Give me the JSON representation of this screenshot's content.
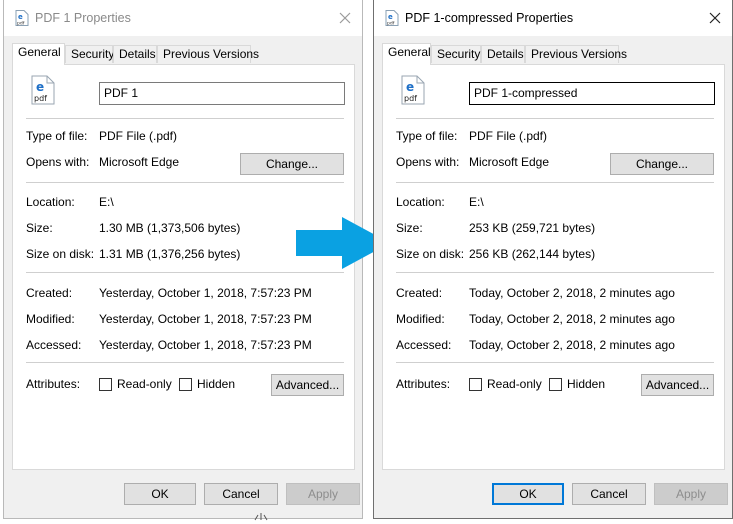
{
  "left": {
    "title": "PDF 1 Properties",
    "tabs": [
      "General",
      "Security",
      "Details",
      "Previous Versions"
    ],
    "file_name": "PDF 1",
    "type_label": "Type of file:",
    "type_value": "PDF File (.pdf)",
    "opens_label": "Opens with:",
    "opens_value": "Microsoft Edge",
    "change_button": "Change...",
    "location_label": "Location:",
    "location_value": "E:\\",
    "size_label": "Size:",
    "size_value": "1.30 MB (1,373,506 bytes)",
    "size_disk_label": "Size on disk:",
    "size_disk_value": "1.31 MB (1,376,256 bytes)",
    "created_label": "Created:",
    "created_value": "Yesterday, October 1, 2018, 7:57:23 PM",
    "modified_label": "Modified:",
    "modified_value": "Yesterday, October 1, 2018, 7:57:23 PM",
    "accessed_label": "Accessed:",
    "accessed_value": "Yesterday, October 1, 2018, 7:57:23 PM",
    "attributes_label": "Attributes:",
    "readonly_label": "Read-only",
    "hidden_label": "Hidden",
    "advanced_button": "Advanced...",
    "ok_button": "OK",
    "cancel_button": "Cancel",
    "apply_button": "Apply"
  },
  "right": {
    "title": "PDF 1-compressed Properties",
    "tabs": [
      "General",
      "Security",
      "Details",
      "Previous Versions"
    ],
    "file_name": "PDF 1-compressed",
    "type_label": "Type of file:",
    "type_value": "PDF File (.pdf)",
    "opens_label": "Opens with:",
    "opens_value": "Microsoft Edge",
    "change_button": "Change...",
    "location_label": "Location:",
    "location_value": "E:\\",
    "size_label": "Size:",
    "size_value": "253 KB (259,721 bytes)",
    "size_disk_label": "Size on disk:",
    "size_disk_value": "256 KB (262,144 bytes)",
    "created_label": "Created:",
    "created_value": "Today, October 2, 2018, 2 minutes ago",
    "modified_label": "Modified:",
    "modified_value": "Today, October 2, 2018, 2 minutes ago",
    "accessed_label": "Accessed:",
    "accessed_value": "Today, October 2, 2018, 2 minutes ago",
    "attributes_label": "Attributes:",
    "readonly_label": "Read-only",
    "hidden_label": "Hidden",
    "advanced_button": "Advanced...",
    "ok_button": "OK",
    "cancel_button": "Cancel",
    "apply_button": "Apply"
  },
  "colors": {
    "arrow": "#0aa1e2",
    "focus_border": "#0078d7",
    "dialog_bg": "#f0f0f0"
  },
  "icons": {
    "file_icon": "pdf-edge-icon",
    "close_icon": "close-icon",
    "arrow_icon": "right-arrow-icon"
  }
}
